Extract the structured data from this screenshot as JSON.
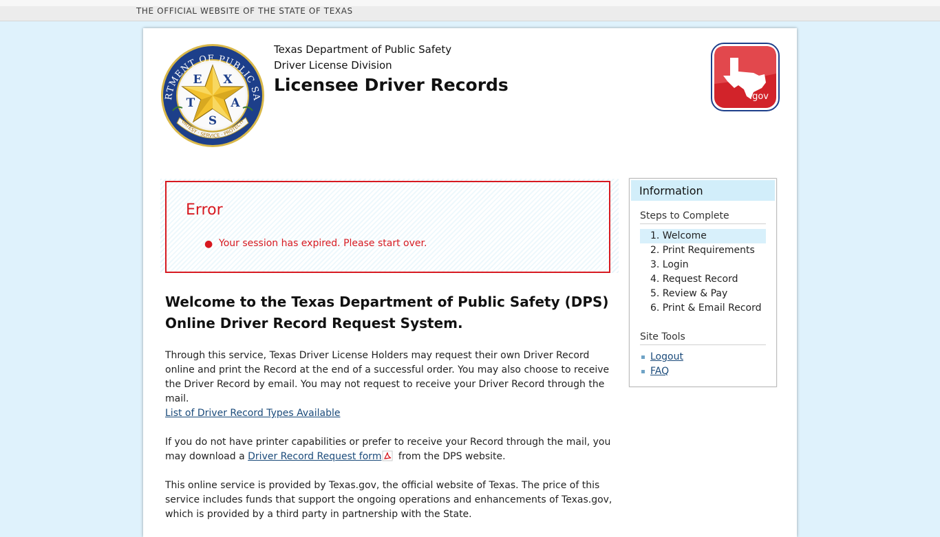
{
  "topbar": {
    "text": "THE OFFICIAL WEBSITE OF THE STATE OF TEXAS"
  },
  "header": {
    "line1": "Texas Department of Public Safety",
    "line2": "Driver License Division",
    "title": "Licensee Driver Records",
    "seal": {
      "ring_text": "DEPARTMENT OF PUBLIC SAFETY",
      "letters": [
        "T",
        "E",
        "X",
        "A",
        "S"
      ],
      "motto": "COURTESY · SERVICE · PROTECTION"
    },
    "gov_logo_text": ".gov"
  },
  "error": {
    "title": "Error",
    "messages": [
      "Your session has expired. Please start over."
    ]
  },
  "main": {
    "welcome": "Welcome to the Texas Department of Public Safety (DPS) Online Driver Record Request System.",
    "para1": "Through this service, Texas Driver License Holders may request their own Driver Record online and print the Record at the end of a successful order. You may also choose to receive the Driver Record by email. You may not request to receive your Driver Record through the mail.",
    "types_link": "List of Driver Record Types Available",
    "para2_before": "If you do not have printer capabilities or prefer to receive your Record through the mail, you may download a ",
    "para2_link": "Driver Record Request form",
    "para2_after": " from the DPS website.",
    "para3": "This online service is provided by Texas.gov, the official website of Texas. The price of this service includes funds that support the ongoing operations and enhancements of Texas.gov, which is provided by a third party in partnership with the State."
  },
  "info": {
    "title": "Information",
    "steps_title": "Steps to Complete",
    "steps": [
      "1. Welcome",
      "2. Print Requirements",
      "3. Login",
      "4. Request Record",
      "5. Review & Pay",
      "6. Print & Email Record"
    ],
    "active_step": 0,
    "tools_title": "Site Tools",
    "tools": [
      "Logout",
      "FAQ"
    ]
  },
  "colors": {
    "background": "#dff2fc",
    "error_red": "#d71920",
    "link": "#1a4a7a",
    "info_header": "#d2eefa",
    "seal_blue": "#1d3f8a",
    "seal_gold": "#f2c12e",
    "gov_red": "#d2232a"
  },
  "icons": {
    "pdf": "pdf-icon",
    "seal": "dps-seal-logo",
    "gov": "texas-gov-logo"
  }
}
